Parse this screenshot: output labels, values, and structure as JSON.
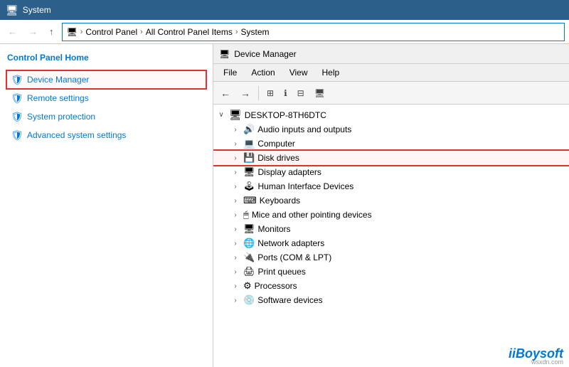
{
  "titlebar": {
    "icon": "🖥",
    "title": "System"
  },
  "addressbar": {
    "back_label": "←",
    "forward_label": "→",
    "up_label": "↑",
    "path": [
      "Control Panel",
      "All Control Panel Items",
      "System"
    ]
  },
  "leftpanel": {
    "home_label": "Control Panel Home",
    "nav_items": [
      {
        "id": "device-manager",
        "label": "Device Manager",
        "highlighted": true
      },
      {
        "id": "remote-settings",
        "label": "Remote settings",
        "highlighted": false
      },
      {
        "id": "system-protection",
        "label": "System protection",
        "highlighted": false
      },
      {
        "id": "advanced-system-settings",
        "label": "Advanced system settings",
        "highlighted": false
      }
    ]
  },
  "devicemanager": {
    "title": "Device Manager",
    "menus": [
      "File",
      "Action",
      "View",
      "Help"
    ],
    "toolbar_buttons": [
      "←",
      "→",
      "⊞",
      "ℹ",
      "⊟",
      "🖥"
    ],
    "computer_name": "DESKTOP-8TH6DTC",
    "tree_items": [
      {
        "level": 1,
        "expand": "›",
        "icon": "🔊",
        "label": "Audio inputs and outputs",
        "highlighted": false
      },
      {
        "level": 1,
        "expand": "›",
        "icon": "💻",
        "label": "Computer",
        "highlighted": false
      },
      {
        "level": 1,
        "expand": "›",
        "icon": "💾",
        "label": "Disk drives",
        "highlighted": true
      },
      {
        "level": 1,
        "expand": "›",
        "icon": "🖥",
        "label": "Display adapters",
        "highlighted": false
      },
      {
        "level": 1,
        "expand": "›",
        "icon": "🕹",
        "label": "Human Interface Devices",
        "highlighted": false
      },
      {
        "level": 1,
        "expand": "›",
        "icon": "⌨",
        "label": "Keyboards",
        "highlighted": false
      },
      {
        "level": 1,
        "expand": "›",
        "icon": "🖱",
        "label": "Mice and other pointing devices",
        "highlighted": false
      },
      {
        "level": 1,
        "expand": "›",
        "icon": "🖥",
        "label": "Monitors",
        "highlighted": false
      },
      {
        "level": 1,
        "expand": "›",
        "icon": "🌐",
        "label": "Network adapters",
        "highlighted": false
      },
      {
        "level": 1,
        "expand": "›",
        "icon": "🔌",
        "label": "Ports (COM & LPT)",
        "highlighted": false
      },
      {
        "level": 1,
        "expand": "›",
        "icon": "🖨",
        "label": "Print queues",
        "highlighted": false
      },
      {
        "level": 1,
        "expand": "›",
        "icon": "⚙",
        "label": "Processors",
        "highlighted": false
      },
      {
        "level": 1,
        "expand": "›",
        "icon": "💿",
        "label": "Software devices",
        "highlighted": false
      }
    ]
  },
  "watermark": {
    "text": "iBoysoft",
    "wsxdn": "wsxdn.com"
  }
}
